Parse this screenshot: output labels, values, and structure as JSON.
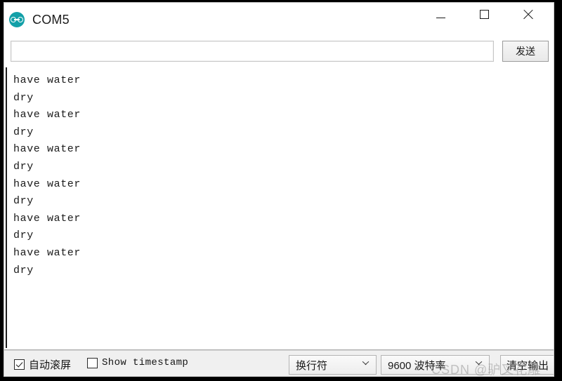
{
  "window": {
    "title": "COM5",
    "app_icon": "arduino-logo-icon",
    "controls": {
      "minimize": "minimize-icon",
      "maximize": "maximize-icon",
      "close": "close-icon"
    }
  },
  "send_row": {
    "input_value": "",
    "input_placeholder": "",
    "send_label": "发送"
  },
  "output": {
    "lines": [
      "have water",
      "dry",
      "have water",
      "dry",
      "have water",
      "dry",
      "have water",
      "dry",
      "have water",
      "dry",
      "have water",
      "dry"
    ],
    "text": "have water\ndry\nhave water\ndry\nhave water\ndry\nhave water\ndry\nhave water\ndry\nhave water\ndry"
  },
  "statusbar": {
    "autoscroll": {
      "label": "自动滚屏",
      "checked": true
    },
    "timestamp": {
      "label": "Show timestamp",
      "checked": false
    },
    "line_ending": {
      "selected": "换行符"
    },
    "baud_rate": {
      "selected": "9600 波特率"
    },
    "clear_label": "清空输出"
  },
  "watermark": {
    "text": "CSDN @驴叉花雕"
  },
  "colors": {
    "accent": "#13a0a8",
    "window_bg": "#ffffff",
    "statusbar_bg": "#f0f0f0",
    "text": "#1a1a1a"
  }
}
